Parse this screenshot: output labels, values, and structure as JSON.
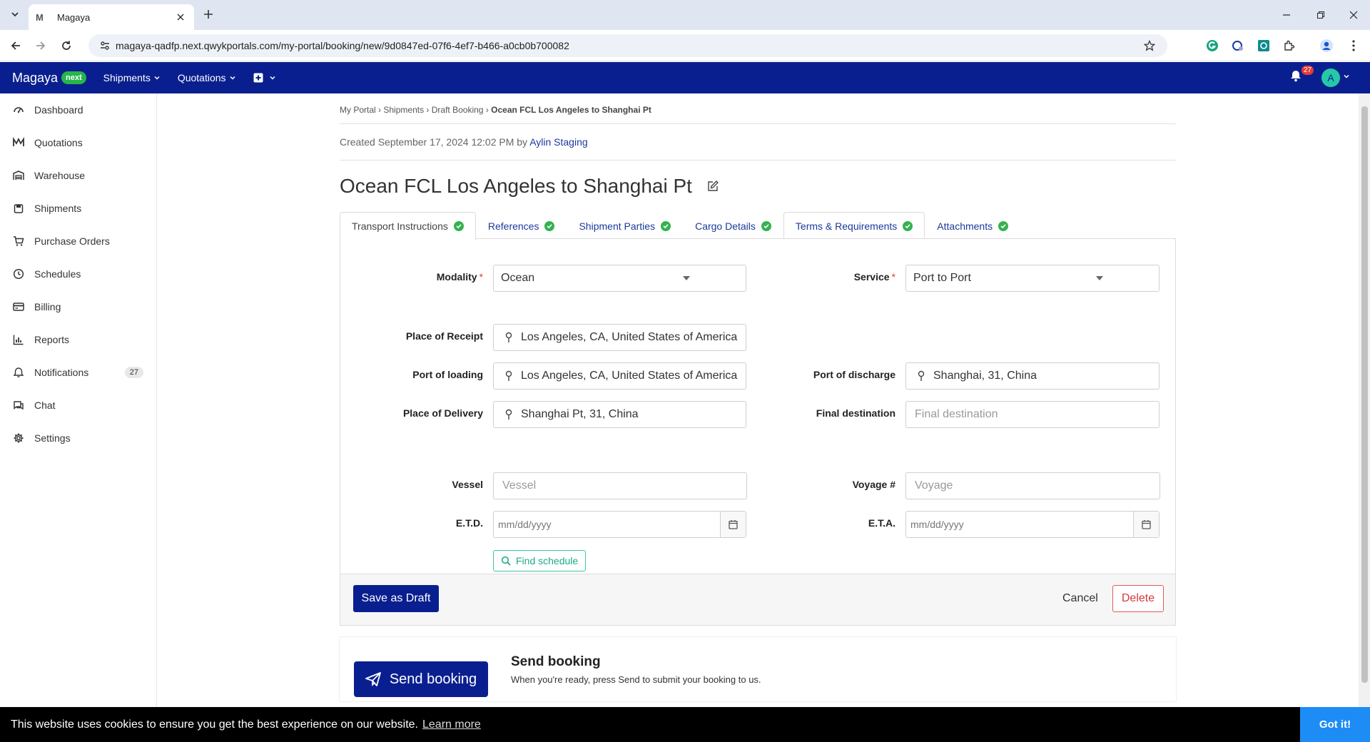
{
  "browser": {
    "tab_title": "Magaya",
    "tab_favicon": "M",
    "url": "magaya-qadfp.next.qwykportals.com/my-portal/booking/new/9d0847ed-07f6-4ef7-b466-a0cb0b700082"
  },
  "appbar": {
    "brand": "Magaya",
    "badge": "next",
    "nav": [
      "Shipments",
      "Quotations"
    ],
    "notification_count": "27",
    "avatar_letter": "A",
    "colors": {
      "bar": "#0a1f8f",
      "badge": "#27b54a"
    }
  },
  "sidebar": {
    "items": [
      {
        "label": "Dashboard",
        "icon": "dashboard-icon"
      },
      {
        "label": "Quotations",
        "icon": "quotations-icon"
      },
      {
        "label": "Warehouse",
        "icon": "warehouse-icon"
      },
      {
        "label": "Shipments",
        "icon": "shipments-icon"
      },
      {
        "label": "Purchase Orders",
        "icon": "cart-icon"
      },
      {
        "label": "Schedules",
        "icon": "clock-icon"
      },
      {
        "label": "Billing",
        "icon": "billing-icon"
      },
      {
        "label": "Reports",
        "icon": "chart-icon"
      },
      {
        "label": "Notifications",
        "icon": "bell-icon",
        "count": "27"
      },
      {
        "label": "Chat",
        "icon": "chat-icon"
      },
      {
        "label": "Settings",
        "icon": "gear-icon"
      }
    ]
  },
  "breadcrumb": {
    "items": [
      "My Portal",
      "Shipments",
      "Draft Booking"
    ],
    "current": "Ocean FCL Los Angeles to Shanghai Pt",
    "separator": "›"
  },
  "created": {
    "prefix": "Created September 17, 2024 12:02 PM by",
    "author": "Aylin Staging"
  },
  "page_title": "Ocean FCL Los Angeles to Shanghai Pt",
  "tabs": [
    "Transport Instructions",
    "References",
    "Shipment Parties",
    "Cargo Details",
    "Terms & Requirements",
    "Attachments"
  ],
  "form": {
    "modality": {
      "label": "Modality",
      "value": "Ocean"
    },
    "service": {
      "label": "Service",
      "value": "Port to Port"
    },
    "place_of_receipt": {
      "label": "Place of Receipt",
      "value": "Los Angeles, CA, United States of America"
    },
    "port_of_loading": {
      "label": "Port of loading",
      "value": "Los Angeles, CA, United States of America"
    },
    "port_of_discharge": {
      "label": "Port of discharge",
      "value": "Shanghai, 31, China"
    },
    "place_of_delivery": {
      "label": "Place of Delivery",
      "value": "Shanghai Pt, 31, China"
    },
    "final_destination": {
      "label": "Final destination",
      "placeholder": "Final destination"
    },
    "vessel": {
      "label": "Vessel",
      "placeholder": "Vessel"
    },
    "voyage": {
      "label": "Voyage #",
      "placeholder": "Voyage"
    },
    "etd": {
      "label": "E.T.D.",
      "placeholder": "mm/dd/yyyy"
    },
    "eta": {
      "label": "E.T.A.",
      "placeholder": "mm/dd/yyyy"
    },
    "find_schedule": "Find schedule"
  },
  "actions": {
    "save_draft": "Save as Draft",
    "cancel": "Cancel",
    "delete": "Delete"
  },
  "send": {
    "button": "Send booking",
    "title": "Send booking",
    "subtitle": "When you're ready, press Send to submit your booking to us."
  },
  "cookie": {
    "message": "This website uses cookies to ensure you get the best experience on our website.",
    "learn_more": "Learn more",
    "accept": "Got it!"
  }
}
